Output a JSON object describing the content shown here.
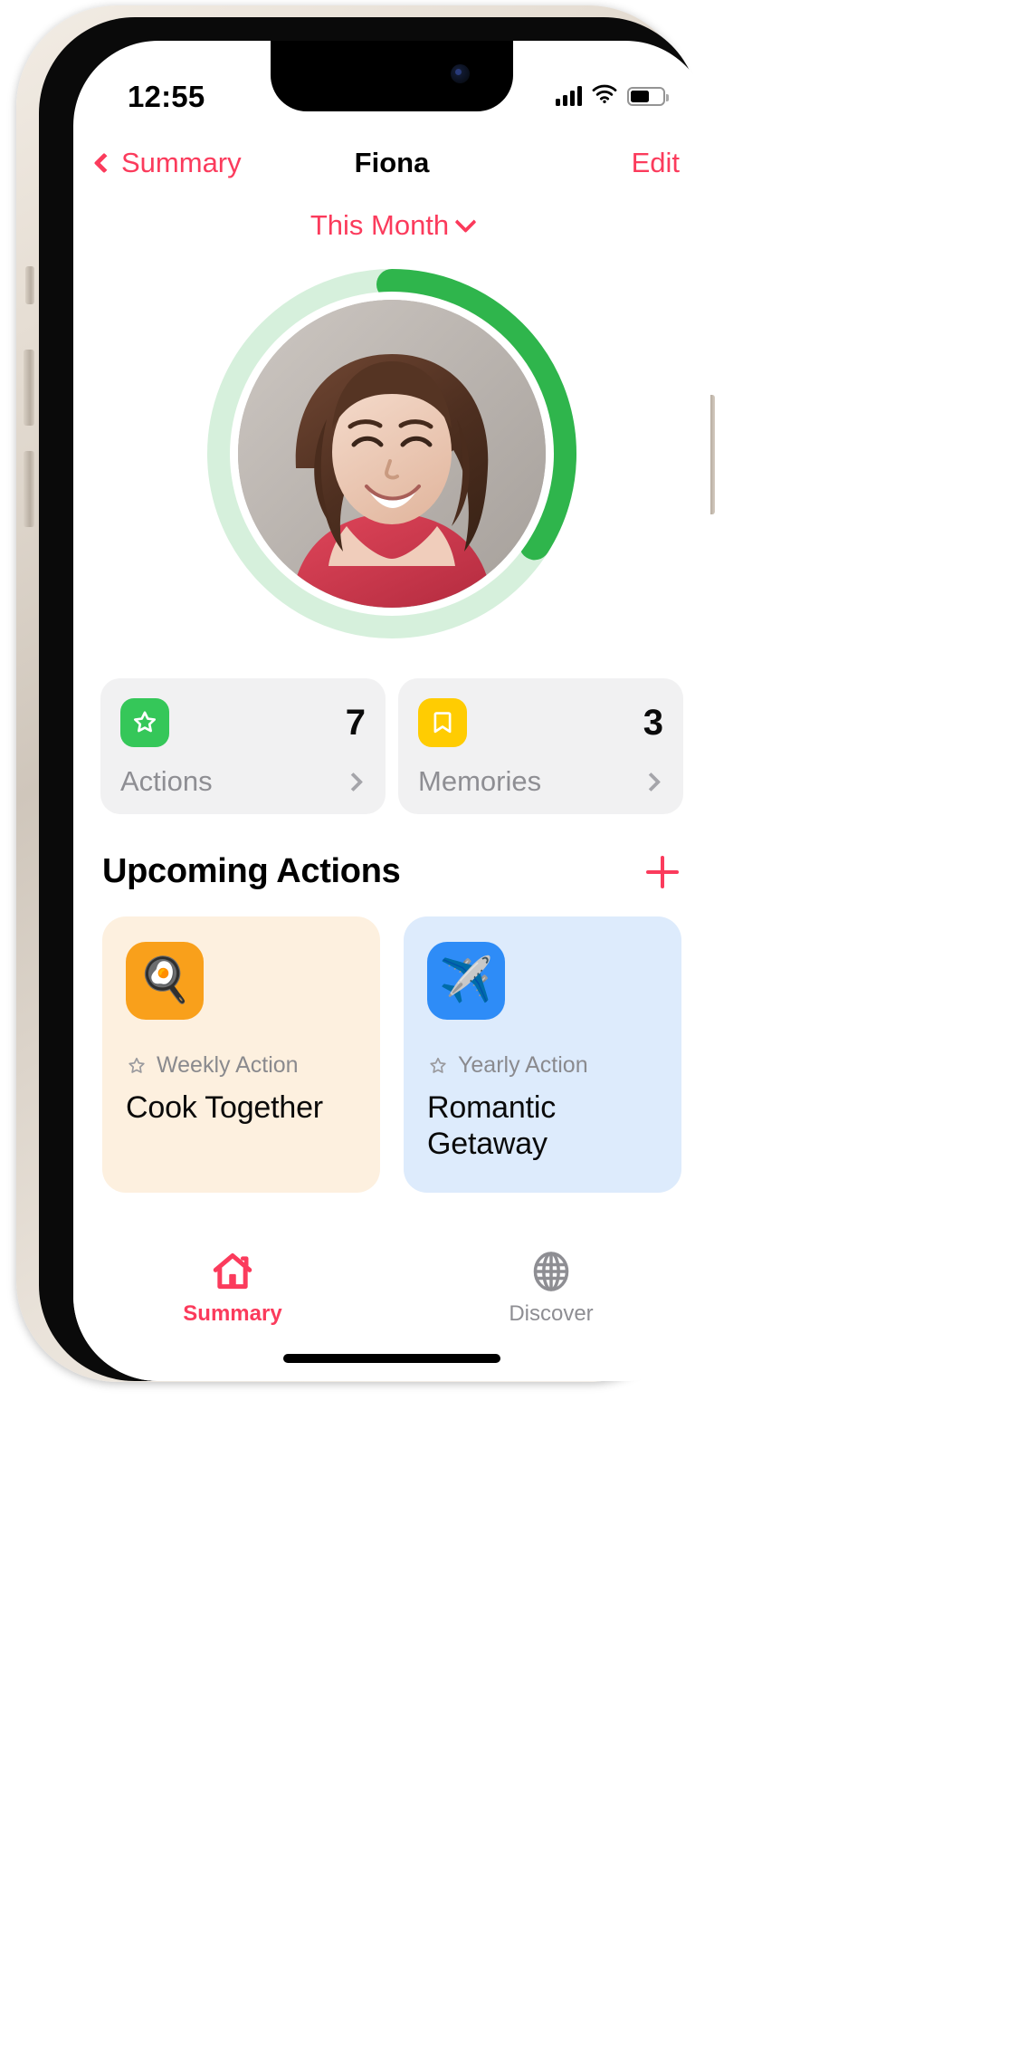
{
  "status_bar": {
    "time": "12:55",
    "cellular_icon": "signal-bars-icon",
    "wifi_icon": "wifi-icon",
    "battery_icon": "battery-icon",
    "battery_level_percent": 58
  },
  "nav_bar": {
    "back_label": "Summary",
    "back_icon": "chevron-left-icon",
    "title": "Fiona",
    "edit_label": "Edit",
    "accent_color": "#FB3B5C"
  },
  "period_selector": {
    "label": "This Month",
    "icon": "chevron-down-icon"
  },
  "profile": {
    "ring": {
      "progress_percent": 34,
      "track_color": "#D6F0DC",
      "progress_color": "#2FB54C"
    },
    "avatar_alt": "Fiona portrait"
  },
  "stats": [
    {
      "icon": "star-badge-icon",
      "icon_color": "#35C759",
      "count": "7",
      "label": "Actions",
      "chevron_icon": "chevron-right-icon"
    },
    {
      "icon": "bookmark-icon",
      "icon_color": "#FFCC02",
      "count": "3",
      "label": "Memories",
      "chevron_icon": "chevron-right-icon"
    }
  ],
  "upcoming": {
    "title": "Upcoming Actions",
    "add_icon": "plus-icon",
    "add_color": "#FB3B5C",
    "cards": [
      {
        "emoji": "🍳",
        "emoji_name": "cooking-pan-icon",
        "tile_color": "#F9A01B",
        "card_color": "#FDF0DF",
        "frequency": "Weekly Action",
        "frequency_icon": "star-outline-icon",
        "title": "Cook Together"
      },
      {
        "emoji": "✈️",
        "emoji_name": "airplane-icon",
        "tile_color": "#2E8CF7",
        "card_color": "#DDEBFC",
        "frequency": "Yearly Action",
        "frequency_icon": "star-outline-icon",
        "title": "Romantic Getaway"
      }
    ]
  },
  "tab_bar": {
    "tabs": [
      {
        "label": "Summary",
        "icon": "house-icon",
        "active": true,
        "color": "#FB3B5C"
      },
      {
        "label": "Discover",
        "icon": "globe-icon",
        "active": false,
        "color": "#8E8E93"
      }
    ]
  }
}
